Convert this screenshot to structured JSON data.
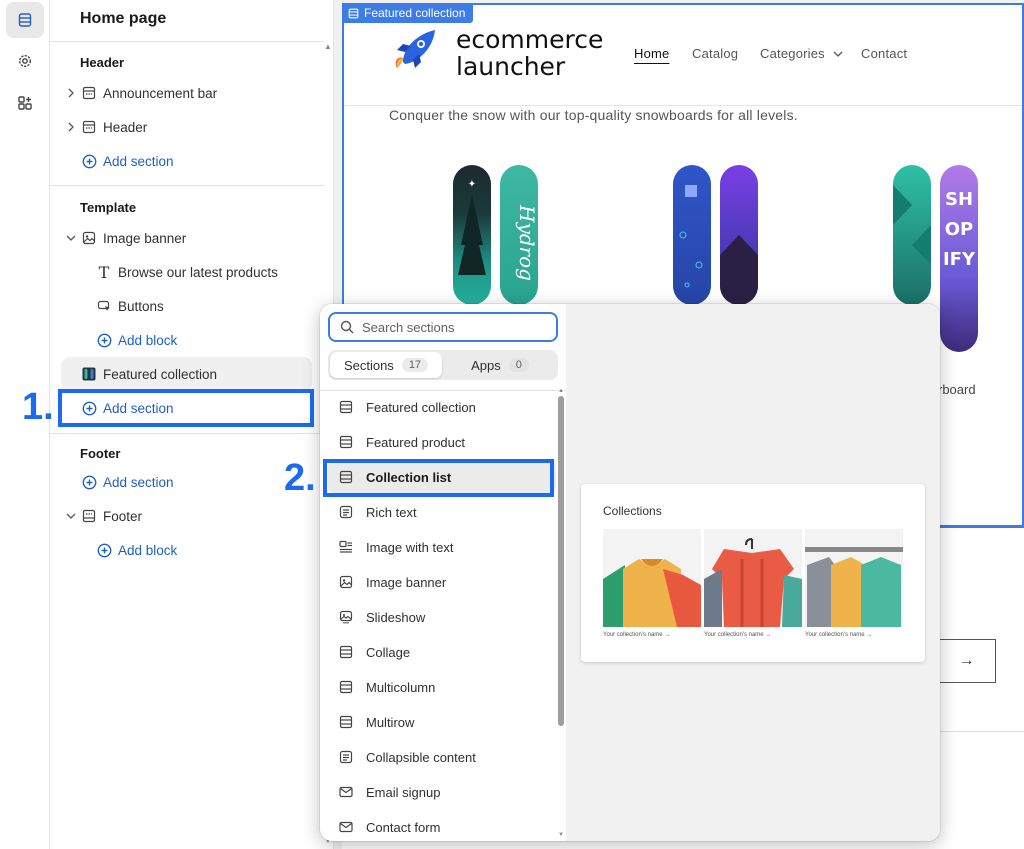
{
  "sidebar": {
    "title": "Home page",
    "header_group": "Header",
    "header_items": [
      {
        "label": "Announcement bar"
      },
      {
        "label": "Header"
      }
    ],
    "header_add_section": "Add section",
    "template_group": "Template",
    "image_banner": "Image banner",
    "image_banner_blocks": [
      {
        "label": "Browse our latest products"
      },
      {
        "label": "Buttons"
      }
    ],
    "image_banner_add_block": "Add block",
    "featured_collection": "Featured collection",
    "template_add_section": "Add section",
    "footer_group": "Footer",
    "footer_add_section": "Add section",
    "footer": "Footer",
    "footer_add_block": "Add block"
  },
  "annotations": {
    "step1": "1.",
    "step2": "2."
  },
  "preview": {
    "selected_tag": "Featured collection",
    "logo_line1": "ecommerce",
    "logo_line2": "launcher",
    "nav": [
      "Home",
      "Catalog",
      "Categories",
      "Contact"
    ],
    "tagline": "Conquer the snow with our top-quality snowboards for all levels.",
    "product_label_partial": "rboard",
    "arrow": "→"
  },
  "popover": {
    "search_placeholder": "Search sections",
    "tabs": [
      {
        "label": "Sections",
        "count": "17"
      },
      {
        "label": "Apps",
        "count": "0"
      }
    ],
    "items": [
      {
        "label": "Featured collection",
        "icon": "section-icon"
      },
      {
        "label": "Featured product",
        "icon": "section-icon"
      },
      {
        "label": "Collection list",
        "icon": "section-icon"
      },
      {
        "label": "Rich text",
        "icon": "text-icon"
      },
      {
        "label": "Image with text",
        "icon": "image-text-icon"
      },
      {
        "label": "Image banner",
        "icon": "image-icon"
      },
      {
        "label": "Slideshow",
        "icon": "slideshow-icon"
      },
      {
        "label": "Collage",
        "icon": "section-icon"
      },
      {
        "label": "Multicolumn",
        "icon": "section-icon"
      },
      {
        "label": "Multirow",
        "icon": "section-icon"
      },
      {
        "label": "Collapsible content",
        "icon": "text-icon"
      },
      {
        "label": "Email signup",
        "icon": "mail-icon"
      },
      {
        "label": "Contact form",
        "icon": "mail-icon"
      }
    ],
    "selected_item": "Collection list",
    "preview_card": {
      "title": "Collections",
      "captions": [
        "Your collection's name →",
        "Your collection's name →",
        "Your collection's name →"
      ]
    }
  },
  "colors": {
    "accent": "#1c6bef",
    "link": "#1f5fbf",
    "selection_outline": "#3d7be5"
  }
}
